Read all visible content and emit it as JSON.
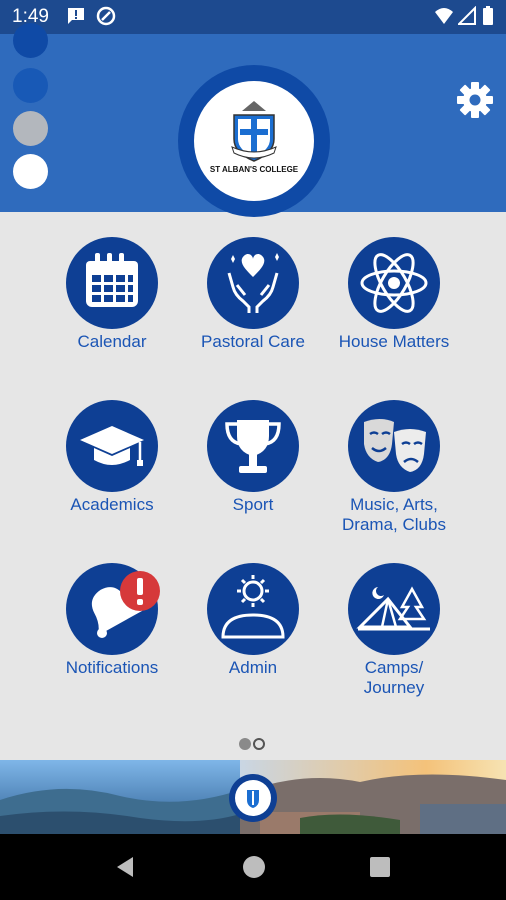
{
  "status_bar": {
    "time": "1:49"
  },
  "header": {
    "logo_text": "ST ALBAN'S COLLEGE"
  },
  "menu": [
    {
      "label": "Calendar",
      "icon": "calendar-icon"
    },
    {
      "label": "Pastoral Care",
      "icon": "hands-heart-icon"
    },
    {
      "label": "House Matters",
      "icon": "atom-icon"
    },
    {
      "label": "Academics",
      "icon": "graduation-cap-icon"
    },
    {
      "label": "Sport",
      "icon": "trophy-icon"
    },
    {
      "label_line1": "Music, Arts,",
      "label_line2": "Drama, Clubs",
      "icon": "theater-masks-icon"
    },
    {
      "label": "Notifications",
      "icon": "bell-alert-icon"
    },
    {
      "label": "Admin",
      "icon": "user-gear-icon"
    },
    {
      "label_line1": "Camps/",
      "label_line2": "Journey",
      "icon": "tent-camping-icon"
    }
  ],
  "colors": {
    "primary": "#0e3f94",
    "header": "#2f6bbd",
    "label": "#1b55b5",
    "alert": "#d6393a"
  }
}
